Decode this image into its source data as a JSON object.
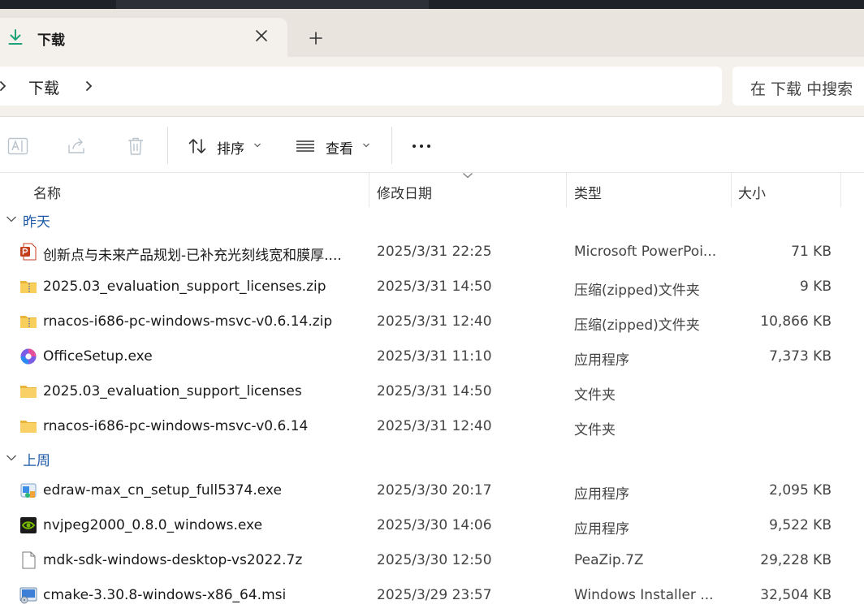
{
  "tab": {
    "title": "下载",
    "icon": "download-arrow-icon"
  },
  "address": {
    "crumb": "下载"
  },
  "search": {
    "placeholder": "在 下载 中搜索"
  },
  "commands": {
    "sort_label": "排序",
    "view_label": "查看"
  },
  "columns": {
    "name": "名称",
    "modified": "修改日期",
    "type": "类型",
    "size": "大小"
  },
  "colors": {
    "accent": "#1c5aa6",
    "tab_bg": "#f4f1ed",
    "titlebar_bg": "#e9e4de"
  },
  "groups": [
    {
      "label": "昨天",
      "rows": [
        {
          "name": "创新点与未来产品规划-已补充光刻线宽和膜厚....",
          "date": "2025/3/31 22:25",
          "type": "Microsoft PowerPoi...",
          "size": "71 KB",
          "icon": "powerpoint-file-icon"
        },
        {
          "name": "2025.03_evaluation_support_licenses.zip",
          "date": "2025/3/31 14:50",
          "type": "压缩(zipped)文件夹",
          "size": "9 KB",
          "icon": "zip-folder-icon"
        },
        {
          "name": "rnacos-i686-pc-windows-msvc-v0.6.14.zip",
          "date": "2025/3/31 12:40",
          "type": "压缩(zipped)文件夹",
          "size": "10,866 KB",
          "icon": "zip-folder-icon"
        },
        {
          "name": "OfficeSetup.exe",
          "date": "2025/3/31 11:10",
          "type": "应用程序",
          "size": "7,373 KB",
          "icon": "office-setup-icon"
        },
        {
          "name": "2025.03_evaluation_support_licenses",
          "date": "2025/3/31 14:50",
          "type": "文件夹",
          "size": "",
          "icon": "folder-icon"
        },
        {
          "name": "rnacos-i686-pc-windows-msvc-v0.6.14",
          "date": "2025/3/31 12:40",
          "type": "文件夹",
          "size": "",
          "icon": "folder-icon"
        }
      ]
    },
    {
      "label": "上周",
      "rows": [
        {
          "name": "edraw-max_cn_setup_full5374.exe",
          "date": "2025/3/30 20:17",
          "type": "应用程序",
          "size": "2,095 KB",
          "icon": "installer-exe-icon"
        },
        {
          "name": "nvjpeg2000_0.8.0_windows.exe",
          "date": "2025/3/30 14:06",
          "type": "应用程序",
          "size": "9,522 KB",
          "icon": "nvidia-exe-icon"
        },
        {
          "name": "mdk-sdk-windows-desktop-vs2022.7z",
          "date": "2025/3/30 12:50",
          "type": "PeaZip.7Z",
          "size": "29,228 KB",
          "icon": "generic-file-icon"
        },
        {
          "name": "cmake-3.30.8-windows-x86_64.msi",
          "date": "2025/3/29 23:57",
          "type": "Windows Installer ...",
          "size": "32,504 KB",
          "icon": "msi-installer-icon"
        }
      ]
    }
  ]
}
